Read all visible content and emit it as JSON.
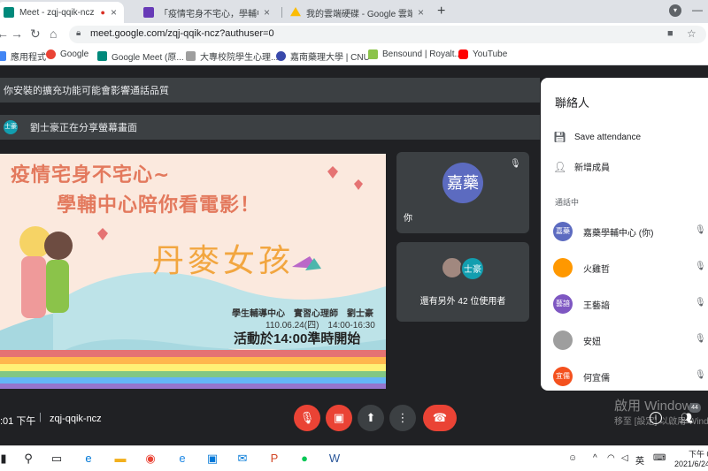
{
  "browser": {
    "tabs": [
      {
        "title": "Meet - zqj-qqik-ncz",
        "favicon_color": "#00897b",
        "status": "●"
      },
      {
        "title": "「疫情宅身不宅心，學輔中心陪你",
        "favicon_color": "#673ab7"
      },
      {
        "title": "我的雲端硬碟 - Google 雲端硬碟",
        "favicon_color": "#fbbc04"
      }
    ],
    "new_tab": "+",
    "url": "meet.google.com/zqj-qqik-ncz?authuser=0",
    "bookmarks": [
      {
        "label": "應用程式",
        "color": "#4285f4"
      },
      {
        "label": "Google",
        "color": "#ea4335"
      },
      {
        "label": "Google Meet (原...",
        "color": "#00897b"
      },
      {
        "label": "大專校院學生心理...",
        "color": "#9e9e9e"
      },
      {
        "label": "嘉南藥理大學 | CNU",
        "color": "#3949ab"
      },
      {
        "label": "Bensound | Royalt...",
        "color": "#8bc34a"
      },
      {
        "label": "YouTube",
        "color": "#ff0000"
      }
    ]
  },
  "meet": {
    "banner_warning": "你安裝的擴充功能可能會影響通話品質",
    "banner_share": "劉士豪正在分享螢幕畫面",
    "share_avatar": "士豪",
    "presentation": {
      "title_line1": "疫情宅身不宅心~",
      "title_line2": "學輔中心陪你看電影！",
      "movie": "丹麥女孩",
      "host": "學生輔導中心　實習心理師　劉士豪",
      "date": "110.06.24(四)　14:00-16:30",
      "start": "活動於14:00準時開始"
    },
    "self_tile": {
      "avatar": "嘉藥",
      "name": "你"
    },
    "others_tile": {
      "avatar": "士豪",
      "text": "還有另外 42 位使用者"
    },
    "time": ":01 下午",
    "meeting_code": "zqj-qqik-ncz",
    "people_count": "44",
    "watermark_line1": "啟用 Windows",
    "watermark_line2": "移至 [設定] 以啟用 Windows"
  },
  "panel": {
    "title": "聯絡人",
    "save_attendance": "Save attendance",
    "add_member": "新增成員",
    "in_call_label": "通話中",
    "participants": [
      {
        "avatar": "嘉藥",
        "name": "嘉藥學輔中心 (你)",
        "color": "#5c6bc0"
      },
      {
        "avatar": "",
        "name": "火雞哲",
        "color": "#ff9800"
      },
      {
        "avatar": "藝諳",
        "name": "王藝諳",
        "color": "#7e57c2"
      },
      {
        "avatar": "",
        "name": "安妞",
        "color": "#9e9e9e"
      },
      {
        "avatar": "宜儒",
        "name": "何宜儒",
        "color": "#f4511e"
      }
    ]
  },
  "taskbar": {
    "ime": "英",
    "time": "下午 0",
    "date": "2021/6/24"
  }
}
